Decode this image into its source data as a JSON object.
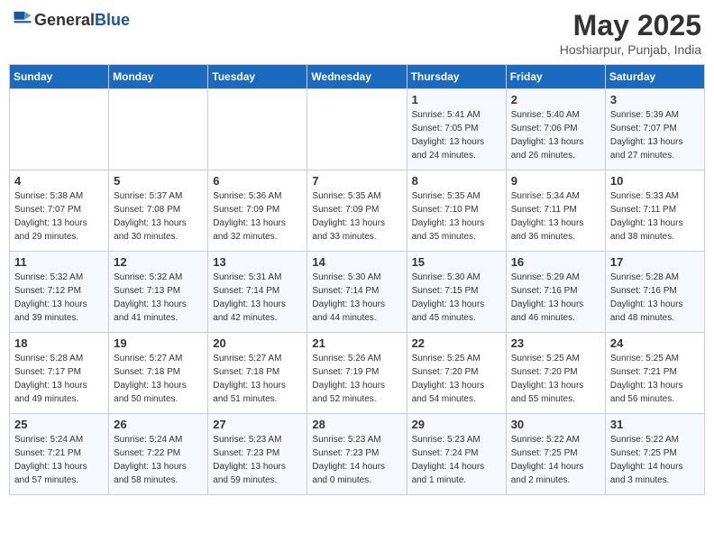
{
  "header": {
    "logo_general": "General",
    "logo_blue": "Blue",
    "month": "May 2025",
    "location": "Hoshiarpur, Punjab, India"
  },
  "days_of_week": [
    "Sunday",
    "Monday",
    "Tuesday",
    "Wednesday",
    "Thursday",
    "Friday",
    "Saturday"
  ],
  "weeks": [
    [
      {
        "day": "",
        "info": ""
      },
      {
        "day": "",
        "info": ""
      },
      {
        "day": "",
        "info": ""
      },
      {
        "day": "",
        "info": ""
      },
      {
        "day": "1",
        "info": "Sunrise: 5:41 AM\nSunset: 7:05 PM\nDaylight: 13 hours\nand 24 minutes."
      },
      {
        "day": "2",
        "info": "Sunrise: 5:40 AM\nSunset: 7:06 PM\nDaylight: 13 hours\nand 26 minutes."
      },
      {
        "day": "3",
        "info": "Sunrise: 5:39 AM\nSunset: 7:07 PM\nDaylight: 13 hours\nand 27 minutes."
      }
    ],
    [
      {
        "day": "4",
        "info": "Sunrise: 5:38 AM\nSunset: 7:07 PM\nDaylight: 13 hours\nand 29 minutes."
      },
      {
        "day": "5",
        "info": "Sunrise: 5:37 AM\nSunset: 7:08 PM\nDaylight: 13 hours\nand 30 minutes."
      },
      {
        "day": "6",
        "info": "Sunrise: 5:36 AM\nSunset: 7:09 PM\nDaylight: 13 hours\nand 32 minutes."
      },
      {
        "day": "7",
        "info": "Sunrise: 5:35 AM\nSunset: 7:09 PM\nDaylight: 13 hours\nand 33 minutes."
      },
      {
        "day": "8",
        "info": "Sunrise: 5:35 AM\nSunset: 7:10 PM\nDaylight: 13 hours\nand 35 minutes."
      },
      {
        "day": "9",
        "info": "Sunrise: 5:34 AM\nSunset: 7:11 PM\nDaylight: 13 hours\nand 36 minutes."
      },
      {
        "day": "10",
        "info": "Sunrise: 5:33 AM\nSunset: 7:11 PM\nDaylight: 13 hours\nand 38 minutes."
      }
    ],
    [
      {
        "day": "11",
        "info": "Sunrise: 5:32 AM\nSunset: 7:12 PM\nDaylight: 13 hours\nand 39 minutes."
      },
      {
        "day": "12",
        "info": "Sunrise: 5:32 AM\nSunset: 7:13 PM\nDaylight: 13 hours\nand 41 minutes."
      },
      {
        "day": "13",
        "info": "Sunrise: 5:31 AM\nSunset: 7:14 PM\nDaylight: 13 hours\nand 42 minutes."
      },
      {
        "day": "14",
        "info": "Sunrise: 5:30 AM\nSunset: 7:14 PM\nDaylight: 13 hours\nand 44 minutes."
      },
      {
        "day": "15",
        "info": "Sunrise: 5:30 AM\nSunset: 7:15 PM\nDaylight: 13 hours\nand 45 minutes."
      },
      {
        "day": "16",
        "info": "Sunrise: 5:29 AM\nSunset: 7:16 PM\nDaylight: 13 hours\nand 46 minutes."
      },
      {
        "day": "17",
        "info": "Sunrise: 5:28 AM\nSunset: 7:16 PM\nDaylight: 13 hours\nand 48 minutes."
      }
    ],
    [
      {
        "day": "18",
        "info": "Sunrise: 5:28 AM\nSunset: 7:17 PM\nDaylight: 13 hours\nand 49 minutes."
      },
      {
        "day": "19",
        "info": "Sunrise: 5:27 AM\nSunset: 7:18 PM\nDaylight: 13 hours\nand 50 minutes."
      },
      {
        "day": "20",
        "info": "Sunrise: 5:27 AM\nSunset: 7:18 PM\nDaylight: 13 hours\nand 51 minutes."
      },
      {
        "day": "21",
        "info": "Sunrise: 5:26 AM\nSunset: 7:19 PM\nDaylight: 13 hours\nand 52 minutes."
      },
      {
        "day": "22",
        "info": "Sunrise: 5:25 AM\nSunset: 7:20 PM\nDaylight: 13 hours\nand 54 minutes."
      },
      {
        "day": "23",
        "info": "Sunrise: 5:25 AM\nSunset: 7:20 PM\nDaylight: 13 hours\nand 55 minutes."
      },
      {
        "day": "24",
        "info": "Sunrise: 5:25 AM\nSunset: 7:21 PM\nDaylight: 13 hours\nand 56 minutes."
      }
    ],
    [
      {
        "day": "25",
        "info": "Sunrise: 5:24 AM\nSunset: 7:21 PM\nDaylight: 13 hours\nand 57 minutes."
      },
      {
        "day": "26",
        "info": "Sunrise: 5:24 AM\nSunset: 7:22 PM\nDaylight: 13 hours\nand 58 minutes."
      },
      {
        "day": "27",
        "info": "Sunrise: 5:23 AM\nSunset: 7:23 PM\nDaylight: 13 hours\nand 59 minutes."
      },
      {
        "day": "28",
        "info": "Sunrise: 5:23 AM\nSunset: 7:23 PM\nDaylight: 14 hours\nand 0 minutes."
      },
      {
        "day": "29",
        "info": "Sunrise: 5:23 AM\nSunset: 7:24 PM\nDaylight: 14 hours\nand 1 minute."
      },
      {
        "day": "30",
        "info": "Sunrise: 5:22 AM\nSunset: 7:25 PM\nDaylight: 14 hours\nand 2 minutes."
      },
      {
        "day": "31",
        "info": "Sunrise: 5:22 AM\nSunset: 7:25 PM\nDaylight: 14 hours\nand 3 minutes."
      }
    ]
  ]
}
